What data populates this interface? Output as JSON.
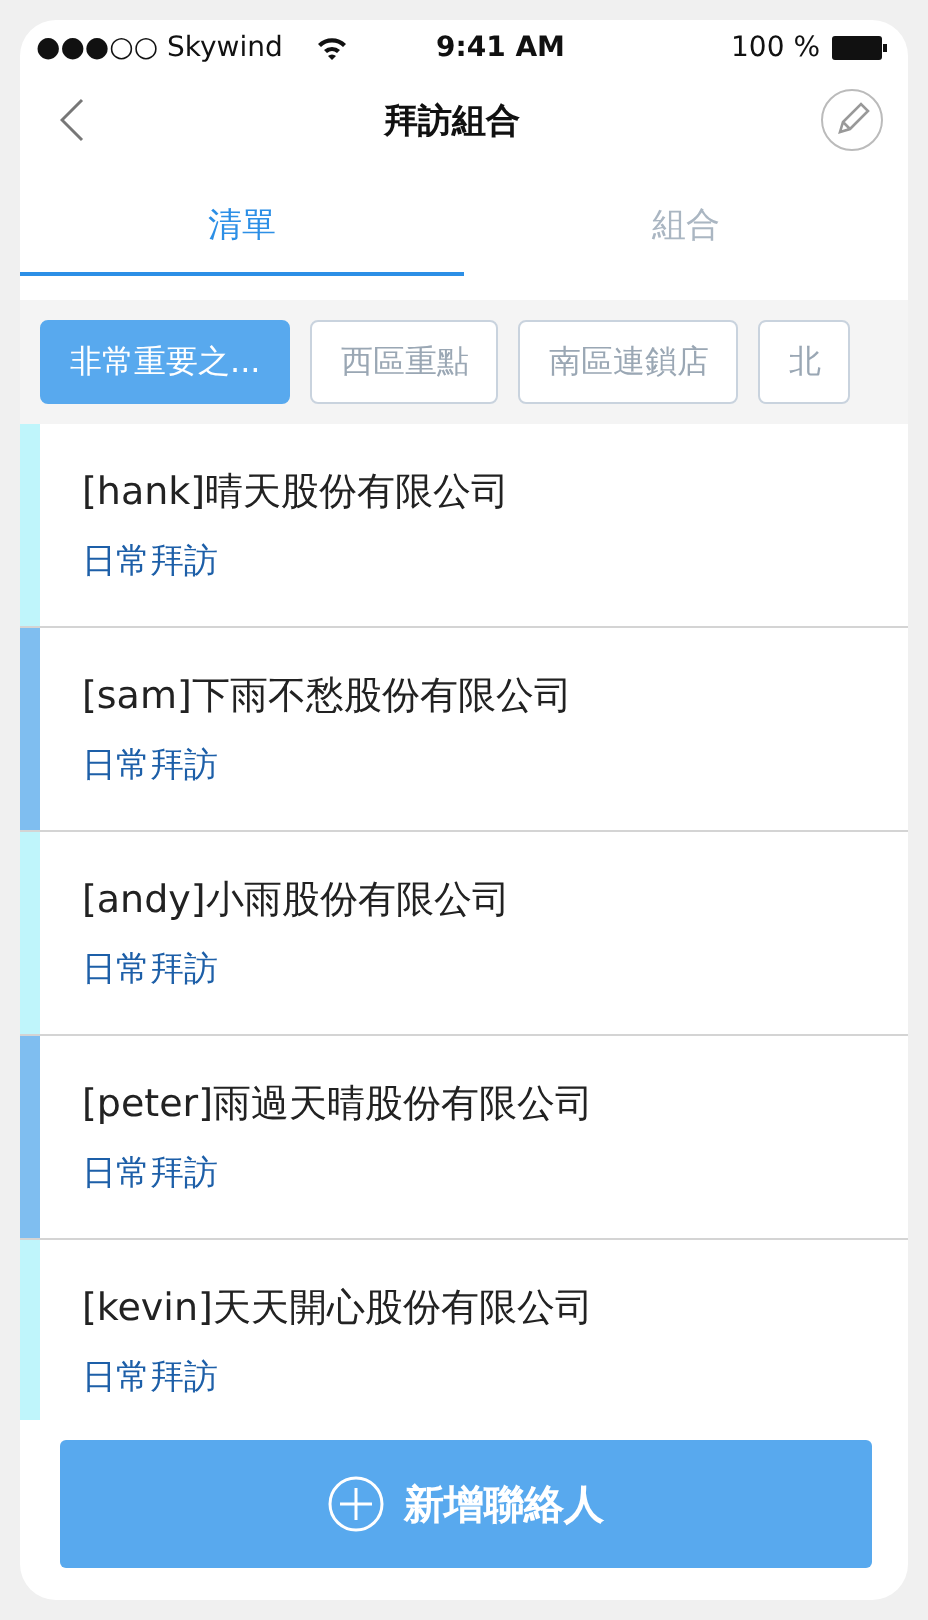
{
  "status_bar": {
    "carrier": "●●●○○ Skywind",
    "time": "9:41 AM",
    "battery": "100 %"
  },
  "nav": {
    "title": "拜訪組合"
  },
  "tabs": [
    {
      "label": "清單",
      "selected": true
    },
    {
      "label": "組合",
      "selected": false
    }
  ],
  "chips": [
    {
      "label": "非常重要之...",
      "selected": true
    },
    {
      "label": "西區重點",
      "selected": false
    },
    {
      "label": "南區連鎖店",
      "selected": false
    },
    {
      "label": "北",
      "selected": false
    }
  ],
  "contacts": [
    {
      "name": "[hank]晴天股份有限公司",
      "type": "日常拜訪",
      "color": "#bff5fb"
    },
    {
      "name": "[sam]下雨不愁股份有限公司",
      "type": "日常拜訪",
      "color": "#7fbef0"
    },
    {
      "name": "[andy]小雨股份有限公司",
      "type": "日常拜訪",
      "color": "#bff5fb"
    },
    {
      "name": "[peter]雨過天晴股份有限公司",
      "type": "日常拜訪",
      "color": "#7fbef0"
    },
    {
      "name": "[kevin]天天開心股份有限公司",
      "type": "日常拜訪",
      "color": "#bff5fb"
    }
  ],
  "add_button": {
    "label": "新增聯絡人"
  }
}
